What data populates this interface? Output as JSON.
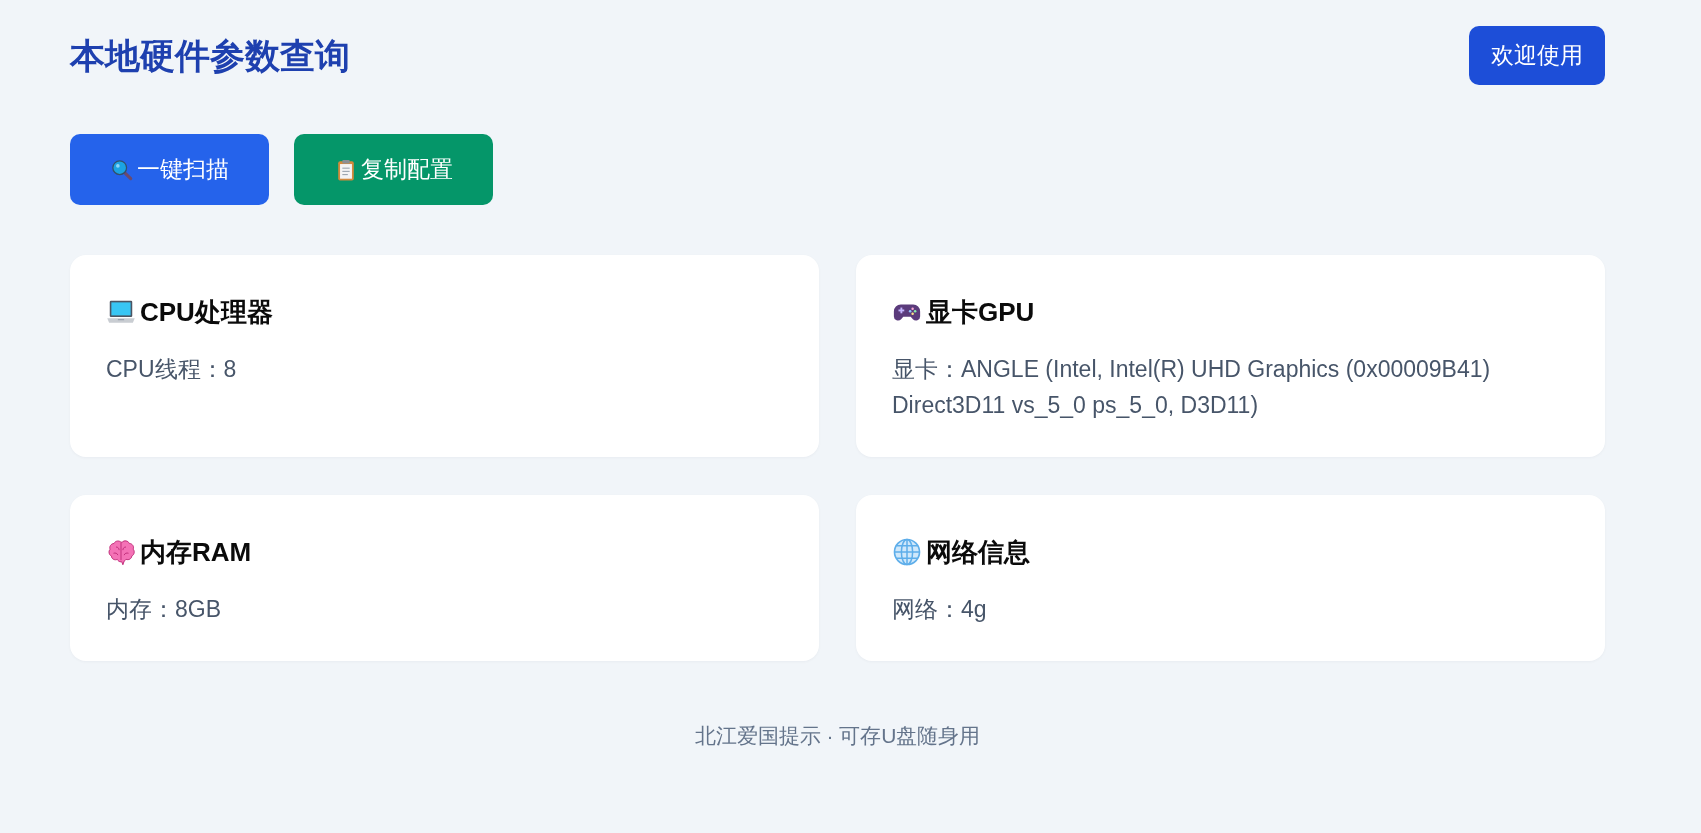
{
  "header": {
    "title": "本地硬件参数查询",
    "welcome_button": "欢迎使用"
  },
  "actions": [
    {
      "kind": "scan",
      "label": "一键扫描"
    },
    {
      "kind": "copy",
      "label": "复制配置"
    }
  ],
  "cards": [
    {
      "kind": "cpu",
      "title": "CPU处理器",
      "detail": "CPU线程：8"
    },
    {
      "kind": "gpu",
      "title": "显卡GPU",
      "detail": "显卡：ANGLE (Intel, Intel(R) UHD Graphics (0x00009B41) Direct3D11 vs_5_0 ps_5_0, D3D11)"
    },
    {
      "kind": "ram",
      "title": "内存RAM",
      "detail": "内存：8GB"
    },
    {
      "kind": "network",
      "title": "网络信息",
      "detail": "网络：4g"
    }
  ],
  "footer": "北江爱国提示 · 可存U盘随身用"
}
